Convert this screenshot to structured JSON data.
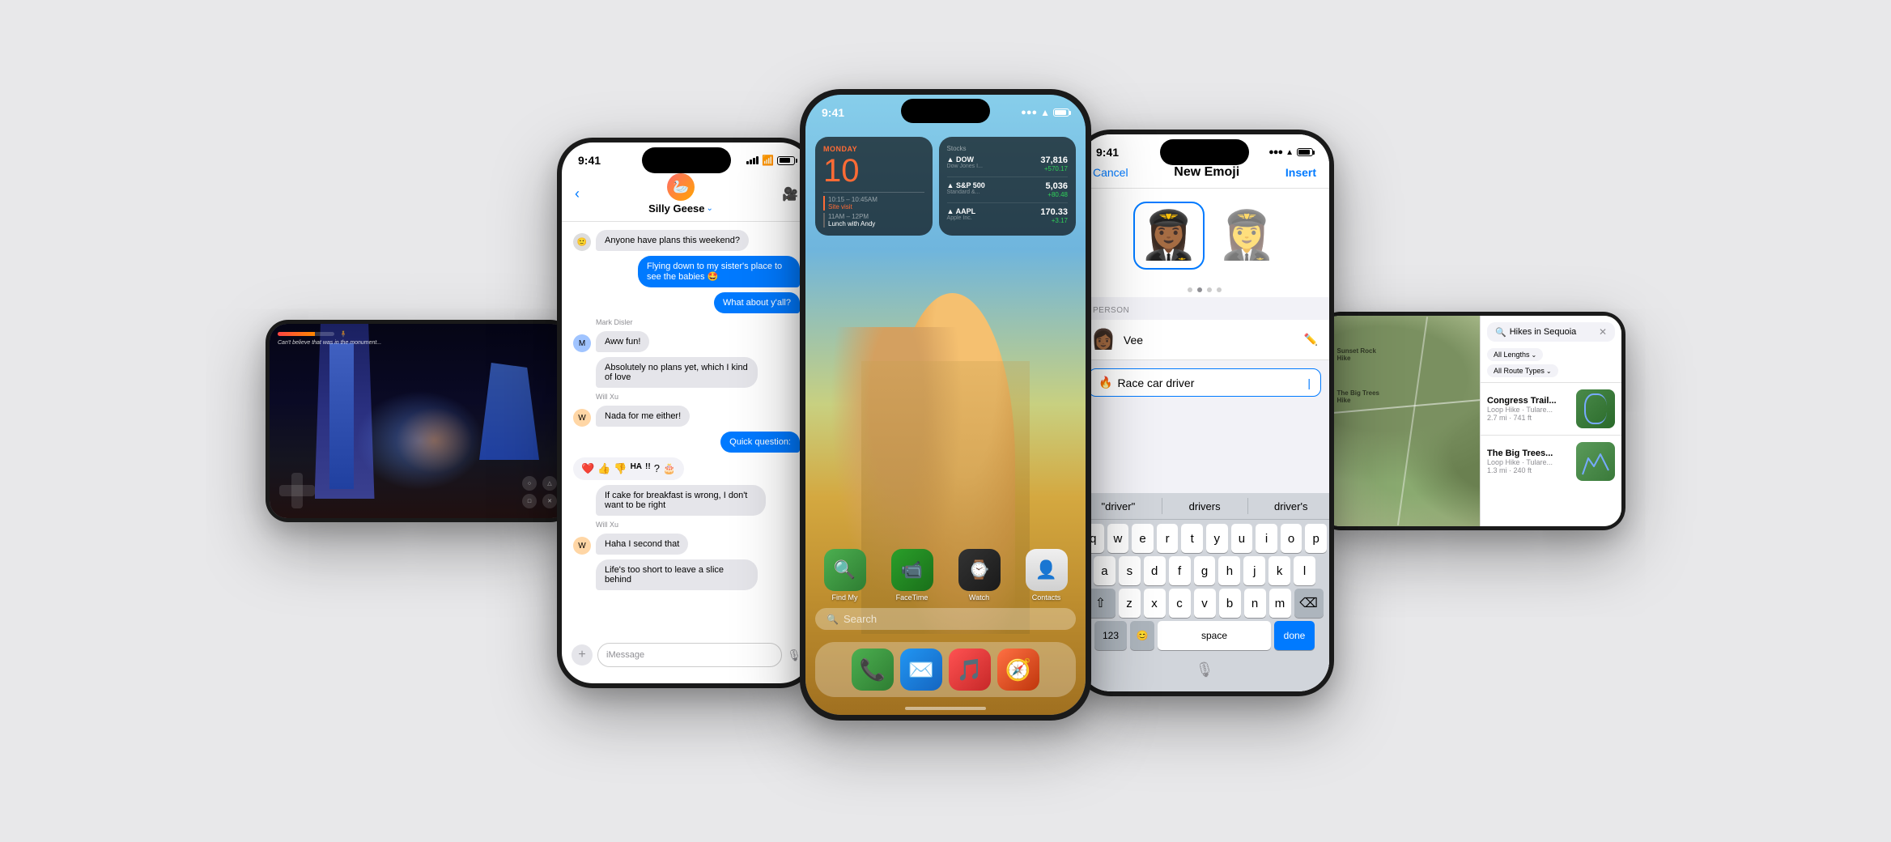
{
  "background": "#e8e8ea",
  "phone_gaming": {
    "label": "gaming-phone",
    "game_text": "Can't believe that was in the monument...",
    "health_pct": 70
  },
  "phone_messages": {
    "label": "messages-phone",
    "status_time": "9:41",
    "group_name": "Silly Geese",
    "messages": [
      {
        "sender": "group",
        "text": "Anyone have plans this weekend?",
        "side": "left",
        "avatar": "🙂"
      },
      {
        "sender": "me",
        "text": "Flying down to my sister's place to see the babies 🤩",
        "side": "right"
      },
      {
        "sender": "me",
        "text": "What about y'all?",
        "side": "right"
      },
      {
        "sender": "Mark Disler",
        "text": "Aww fun!",
        "side": "left",
        "avatar": "👨"
      },
      {
        "sender": "Mark Disler",
        "text": "Absolutely no plans yet, which I kind of love",
        "side": "left",
        "avatar": "👨"
      },
      {
        "sender": "Will Xu",
        "text": "Nada for me either!",
        "side": "left",
        "avatar": "👦"
      },
      {
        "sender": "me",
        "text": "Quick question:",
        "side": "right"
      },
      {
        "sender": "Mark Disler",
        "text": "If cake for breakfast is wrong, I don't want to be right",
        "side": "left",
        "avatar": "👨"
      },
      {
        "sender": "Will Xu",
        "text": "Haha I second that",
        "side": "left",
        "avatar": "👦"
      },
      {
        "sender": "Will Xu",
        "text": "Life's too short to leave a slice behind",
        "side": "left",
        "avatar": "👦"
      }
    ],
    "reactions": [
      "❤️",
      "👍",
      "👎",
      "HA",
      "!!",
      "?",
      "🎂"
    ],
    "input_placeholder": "iMessage"
  },
  "phone_home": {
    "label": "home-screen-phone",
    "status_time": "9:41",
    "widgets": {
      "calendar": {
        "day_name": "MONDAY",
        "day_number": "10",
        "events": [
          {
            "time": "10:15 – 10:45AM",
            "title": "Site visit"
          },
          {
            "time": "11AM – 12PM",
            "title": "Lunch with Andy"
          }
        ]
      },
      "stocks": {
        "items": [
          {
            "symbol": "▲ DOW",
            "company": "Dow Jones I...",
            "price": "37,816",
            "change": "+570.17"
          },
          {
            "symbol": "▲ S&P 500",
            "company": "Standard &...",
            "price": "5,036",
            "change": "+80.48"
          },
          {
            "symbol": "▲ AAPL",
            "company": "Apple Inc.",
            "price": "170.33",
            "change": "+3.17"
          }
        ]
      }
    },
    "apps": [
      {
        "name": "Find My",
        "icon": "🔍",
        "color_class": "app-findmy"
      },
      {
        "name": "FaceTime",
        "icon": "📹",
        "color_class": "app-facetime"
      },
      {
        "name": "Watch",
        "icon": "⌚",
        "color_class": "app-watch"
      },
      {
        "name": "Contacts",
        "icon": "👤",
        "color_class": "app-contacts"
      }
    ],
    "dock_apps": [
      {
        "name": "Phone",
        "icon": "📞",
        "color_class": "app-phone"
      },
      {
        "name": "Mail",
        "icon": "✉️",
        "color_class": "app-mail"
      },
      {
        "name": "Music",
        "icon": "🎵",
        "color_class": "app-music"
      },
      {
        "name": "Compass",
        "icon": "🧭",
        "color_class": "app-compass"
      }
    ],
    "search_label": "Search"
  },
  "phone_emoji": {
    "label": "emoji-creator-phone",
    "status_time": "9:41",
    "nav": {
      "cancel": "Cancel",
      "title": "New Emoji",
      "insert": "Insert"
    },
    "person_label": "PERSON",
    "person_name": "Vee",
    "typed_text": "Race car driver",
    "autocomplete": [
      "\"driver\"",
      "drivers",
      "driver's"
    ],
    "keyboard_rows": [
      [
        "q",
        "w",
        "e",
        "r",
        "t",
        "y",
        "u",
        "i",
        "o",
        "p"
      ],
      [
        "a",
        "s",
        "d",
        "f",
        "g",
        "h",
        "j",
        "k",
        "l"
      ],
      [
        "z",
        "x",
        "c",
        "v",
        "b",
        "n",
        "m"
      ],
      [
        "123",
        "space",
        "done"
      ]
    ]
  },
  "phone_maps": {
    "label": "maps-phone",
    "search_text": "Hikes in Sequoia",
    "filters": [
      "All Lengths",
      "All Route Types"
    ],
    "results": [
      {
        "name": "Congress Trail...",
        "type": "Loop Hike · Tulare...",
        "distance": "2.7 mi",
        "elevation": "741 ft"
      },
      {
        "name": "The Big Trees...",
        "type": "Loop Hike · Tulare...",
        "distance": "1.3 mi",
        "elevation": "240 ft"
      }
    ]
  }
}
